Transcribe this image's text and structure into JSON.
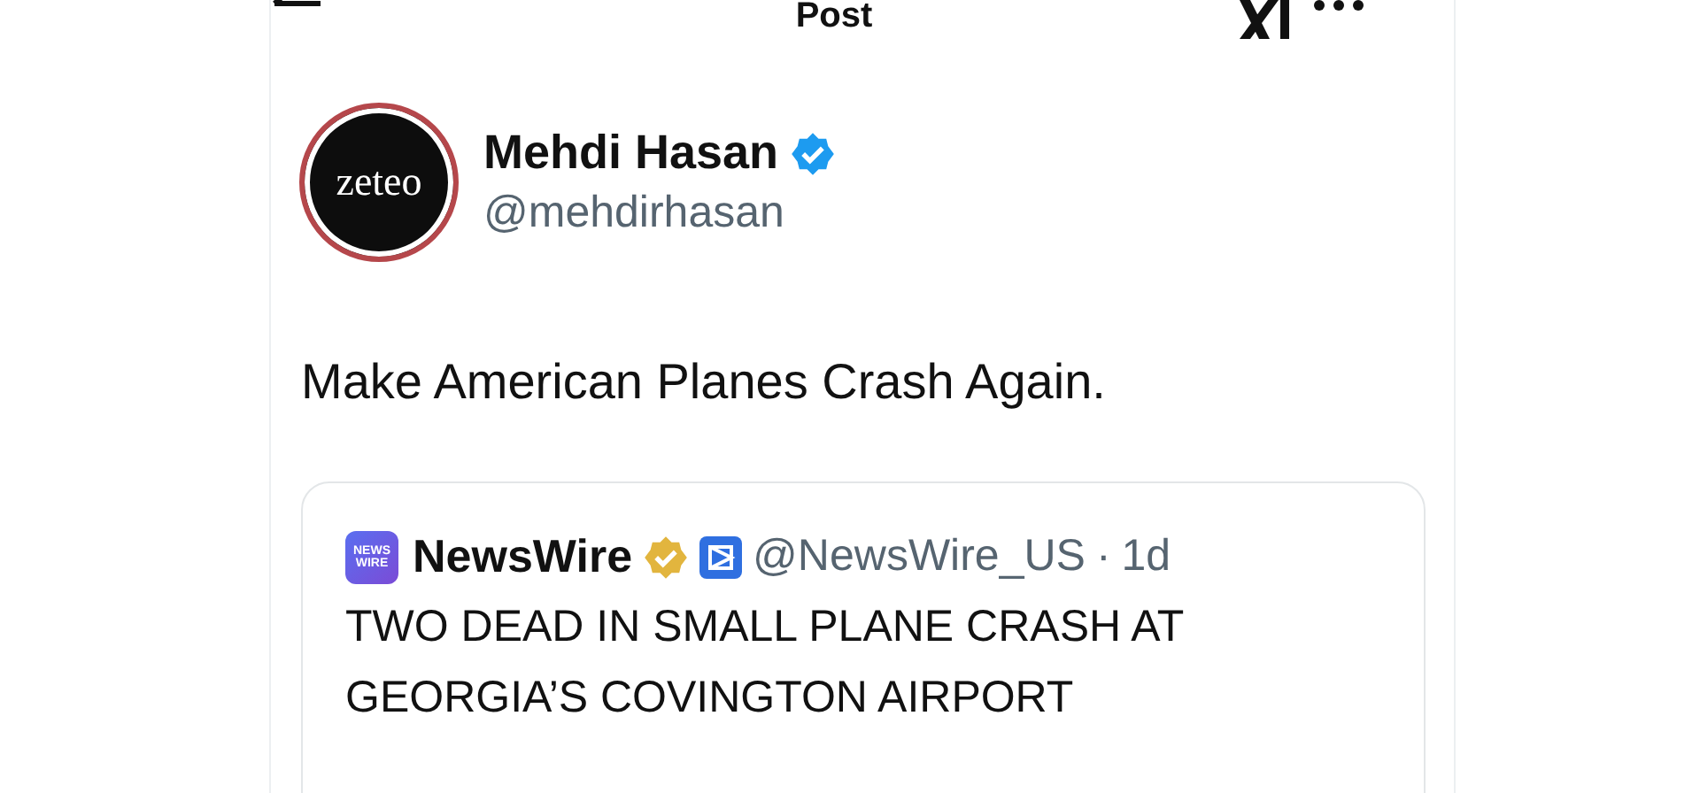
{
  "header": {
    "title": "Post"
  },
  "post": {
    "avatar_text": "zeteo",
    "author": "Mehdi Hasan",
    "verified": true,
    "handle": "@mehdirhasan",
    "text": "Make American Planes Crash Again.",
    "quote": {
      "logo_text": "NEWS WIRE",
      "author": "NewsWire",
      "verified": true,
      "handle": "@NewsWire_US",
      "separator": "·",
      "time": "1d",
      "text": "TWO DEAD IN SMALL PLANE CRASH AT GEORGIA’S COVINGTON AIRPORT"
    }
  }
}
